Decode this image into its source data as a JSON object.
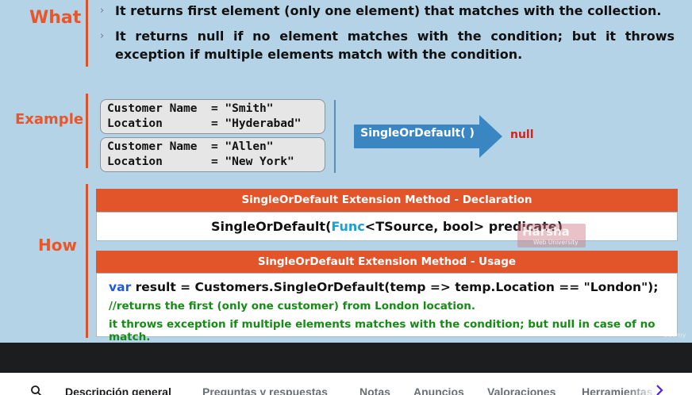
{
  "slide": {
    "what_label": "What",
    "example_label": "Example",
    "how_label": "How",
    "bullets": [
      "It returns first element (only one element) that matches with the collection.",
      "It returns null if no element matches with the condition; but it throws exception if multiple elements match with the condition."
    ],
    "bullet_icon": "chevron-right-icon",
    "customers": [
      {
        "name_line": "Customer Name  = \"Smith\"",
        "loc_line": "Location       = \"Hyderabad\""
      },
      {
        "name_line": "Customer Name  = \"Allen\"",
        "loc_line": "Location       = \"New York\""
      }
    ],
    "arrow_label": "SingleOrDefault( )",
    "result_label": "null",
    "declaration": {
      "header": "SingleOrDefault Extension Method - Declaration",
      "code_prefix": "SingleOrDefault(",
      "code_keyword": "Func",
      "code_suffix": "<TSource, bool>  predicate)"
    },
    "usage": {
      "header": "SingleOrDefault Extension Method - Usage",
      "code_keyword": "var",
      "code_rest": " result = Customers.SingleOrDefault(temp => temp.Location == \"London\");",
      "comment1": "//returns the first (only one customer) from London location.",
      "comment2": "it throws exception if multiple elements matches with the condition; but null in case of no match."
    },
    "watermark_title": "Harsha",
    "watermark_sub": "Web University",
    "udemy_mark": "Udemy",
    "colors": {
      "slide_bg": "#b5d3e6",
      "accent": "#e2552a",
      "arrow": "#3a86c2",
      "null": "#d4221b",
      "comment": "#168c16",
      "keyword": "#1f57e0"
    }
  },
  "tabs": {
    "search_icon": "search-icon",
    "items": [
      "Descripción general",
      "Preguntas y respuestas",
      "Notas",
      "Anuncios",
      "Valoraciones",
      "Herramientas"
    ],
    "active_index": 0,
    "next_icon": "chevron-right-icon"
  }
}
